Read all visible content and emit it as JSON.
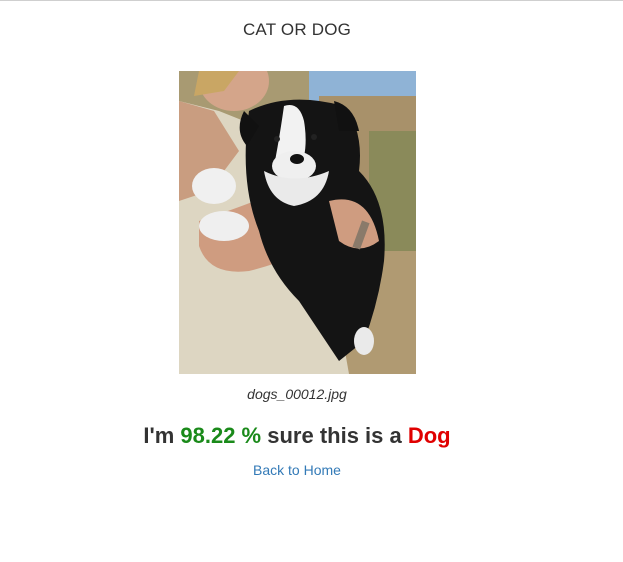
{
  "page": {
    "title": "CAT OR DOG"
  },
  "result": {
    "image_filename": "dogs_00012.jpg",
    "prefix": "I'm ",
    "confidence": "98.22 %",
    "middle": " sure this is a ",
    "prediction": "Dog"
  },
  "nav": {
    "back_label": "Back to Home"
  },
  "colors": {
    "confidence": "#1a8a1a",
    "prediction": "#e00000",
    "link": "#337ab7"
  }
}
